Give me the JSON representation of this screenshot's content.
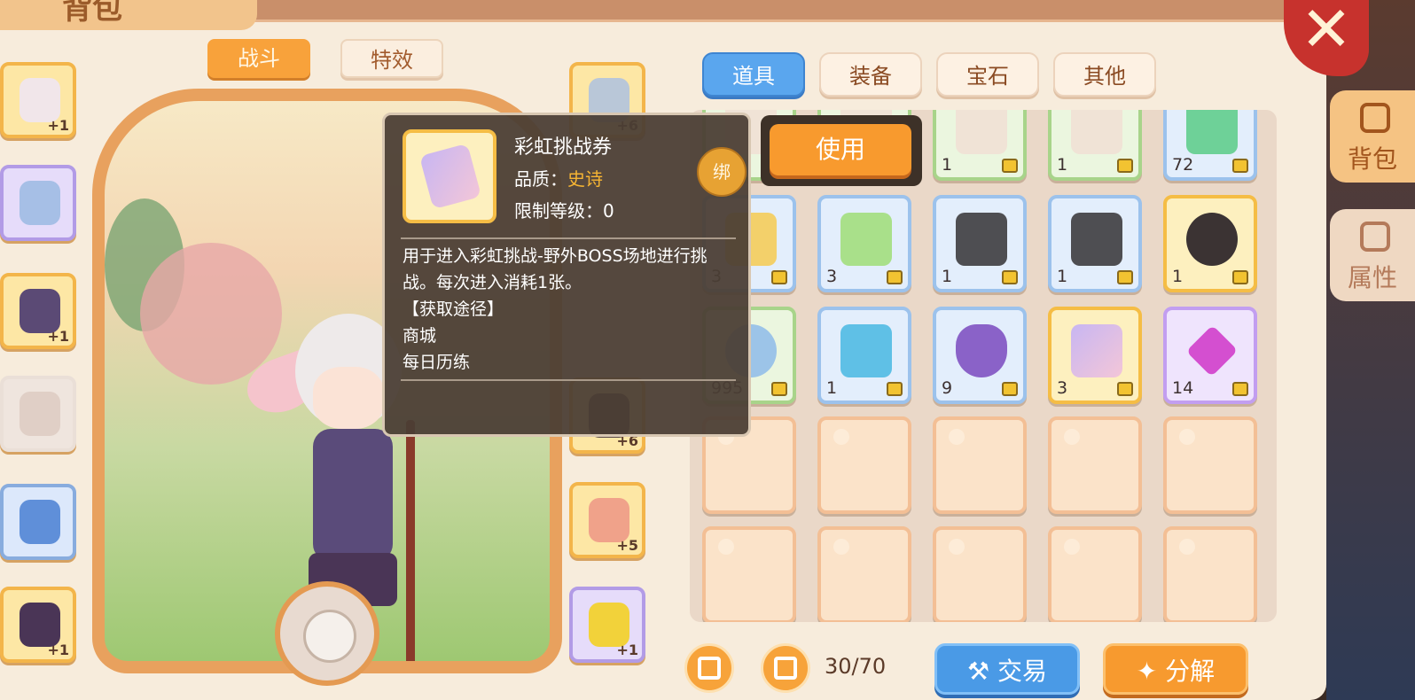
{
  "header": {
    "title": "背包"
  },
  "char_tabs": [
    {
      "label": "战斗",
      "active": true
    },
    {
      "label": "特效",
      "active": false
    }
  ],
  "left_gear": [
    {
      "name": "helmet",
      "plus": "+1",
      "rarity": "gold"
    },
    {
      "name": "armor",
      "plus": "",
      "rarity": "purple"
    },
    {
      "name": "chest",
      "plus": "+1",
      "rarity": "gold"
    },
    {
      "name": "cloak",
      "plus": "",
      "rarity": "empty"
    },
    {
      "name": "gloves",
      "plus": "",
      "rarity": "blue"
    },
    {
      "name": "boots",
      "plus": "+1",
      "rarity": "gold"
    }
  ],
  "right_gear": [
    {
      "name": "sword",
      "plus": "+6",
      "rarity": "gold"
    },
    {
      "name": "earrings",
      "plus": "+6",
      "rarity": "gold"
    },
    {
      "name": "ring",
      "plus": "+5",
      "rarity": "gold"
    },
    {
      "name": "shoes",
      "plus": "+1",
      "rarity": "purple"
    }
  ],
  "bag_tabs": [
    {
      "label": "道具",
      "active": true
    },
    {
      "label": "装备",
      "active": false
    },
    {
      "label": "宝石",
      "active": false
    },
    {
      "label": "其他",
      "active": false
    }
  ],
  "side_tabs": [
    {
      "label": "背包",
      "active": true
    },
    {
      "label": "属性",
      "active": false
    }
  ],
  "items": [
    {
      "qty": "",
      "rarity": "green",
      "locked": false
    },
    {
      "qty": "",
      "rarity": "green",
      "locked": false
    },
    {
      "qty": "1",
      "rarity": "green",
      "locked": true
    },
    {
      "qty": "1",
      "rarity": "green",
      "locked": true
    },
    {
      "qty": "72",
      "rarity": "blue",
      "locked": true
    },
    {
      "qty": "3",
      "rarity": "blue",
      "locked": true
    },
    {
      "qty": "3",
      "rarity": "blue",
      "locked": true
    },
    {
      "qty": "1",
      "rarity": "blue",
      "locked": true
    },
    {
      "qty": "1",
      "rarity": "blue",
      "locked": true
    },
    {
      "qty": "1",
      "rarity": "gold",
      "locked": true
    },
    {
      "qty": "995",
      "rarity": "green",
      "locked": true
    },
    {
      "qty": "1",
      "rarity": "blue",
      "locked": true
    },
    {
      "qty": "9",
      "rarity": "blue",
      "locked": true
    },
    {
      "qty": "3",
      "rarity": "gold",
      "locked": true
    },
    {
      "qty": "14",
      "rarity": "purple",
      "locked": true
    }
  ],
  "tooltip": {
    "name": "彩虹挑战券",
    "quality_label": "品质：",
    "quality_value": "史诗",
    "level_label": "限制等级：0",
    "bind_label": "绑",
    "description": "用于进入彩虹挑战-野外BOSS场地进行挑战。每次进入消耗1张。",
    "source_title": "【获取途径】",
    "sources": [
      "商城",
      "每日历练"
    ]
  },
  "use_button": "使用",
  "footer": {
    "capacity": "30/70",
    "trade_button": "交易",
    "decompose_button": "分解"
  },
  "colors": {
    "accent_orange": "#f89a2e",
    "tab_blue": "#5aa6ee",
    "epic_text": "#f6b533",
    "close_red": "#c7322d"
  }
}
